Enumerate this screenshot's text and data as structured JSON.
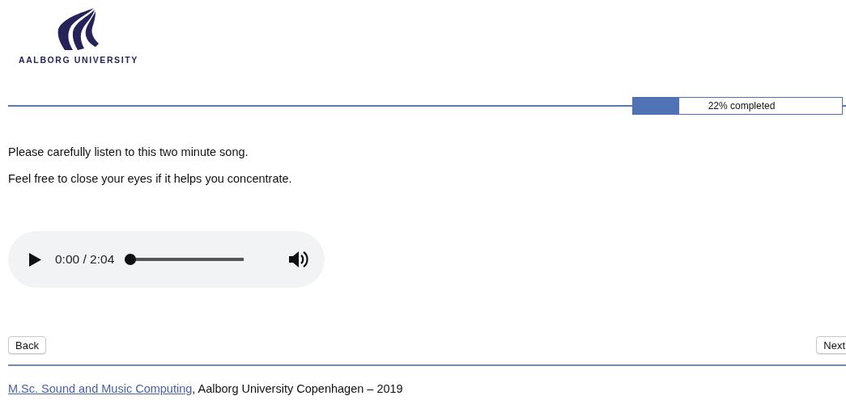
{
  "logo": {
    "text": "AALBORG UNIVERSITY"
  },
  "progress": {
    "level": 0.22,
    "label": "22% completed"
  },
  "instructions": [
    "Please carefully listen to this two minute song.",
    "Feel free to close your eyes if it helps you concentrate."
  ],
  "audio_player": {
    "time": "0:00 / 2:04",
    "seek": {
      "level": 0
    }
  },
  "buttons": {
    "back": "Back",
    "next": "Next"
  },
  "footer": {
    "link": "M.Sc. Sound and Music Computing",
    "text": ", Aalborg University Copenhagen – 2019"
  }
}
